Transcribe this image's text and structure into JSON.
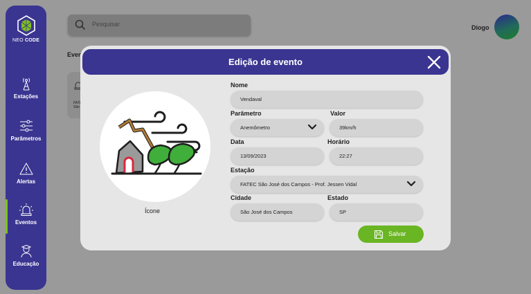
{
  "sidebar": {
    "logo": {
      "text_light": "NEO ",
      "text_bold": "CODE"
    },
    "items": [
      {
        "label": "Estações",
        "icon": "antenna-icon"
      },
      {
        "label": "Parâmetros",
        "icon": "sliders-icon"
      },
      {
        "label": "Alertas",
        "icon": "warning-icon"
      },
      {
        "label": "Eventos",
        "icon": "siren-icon"
      },
      {
        "label": "Educação",
        "icon": "graduate-icon"
      }
    ],
    "active_item": "Eventos"
  },
  "search": {
    "placeholder": "Pesquisar"
  },
  "background": {
    "heading": "Even",
    "card_text_1": "FATEC",
    "card_text_2": "São"
  },
  "user": {
    "name": "Diogo"
  },
  "modal": {
    "title": "Edição de evento",
    "icon_label": "Ícone",
    "fields": {
      "nome": {
        "label": "Nome",
        "value": "Vendaval"
      },
      "parametro": {
        "label": "Parâmetro",
        "value": "Anemômetro"
      },
      "valor": {
        "label": "Valor",
        "value": "39km/h"
      },
      "data": {
        "label": "Data",
        "value": "13/09/2023"
      },
      "horario": {
        "label": "Horário",
        "value": "22:27"
      },
      "estacao": {
        "label": "Estação",
        "value": "FATEC São José dos Campos - Prof. Jessen Vidal"
      },
      "cidade": {
        "label": "Cidade",
        "value": "São José dos Campos"
      },
      "estado": {
        "label": "Estado",
        "value": "SP"
      }
    },
    "save_label": "Salvar"
  },
  "colors": {
    "primary": "#3a3591",
    "accent_green": "#6ab523",
    "overlay_bg": "#9a9a9a",
    "modal_bg": "#e6e6e6",
    "field_bg": "#d4d4d4"
  }
}
